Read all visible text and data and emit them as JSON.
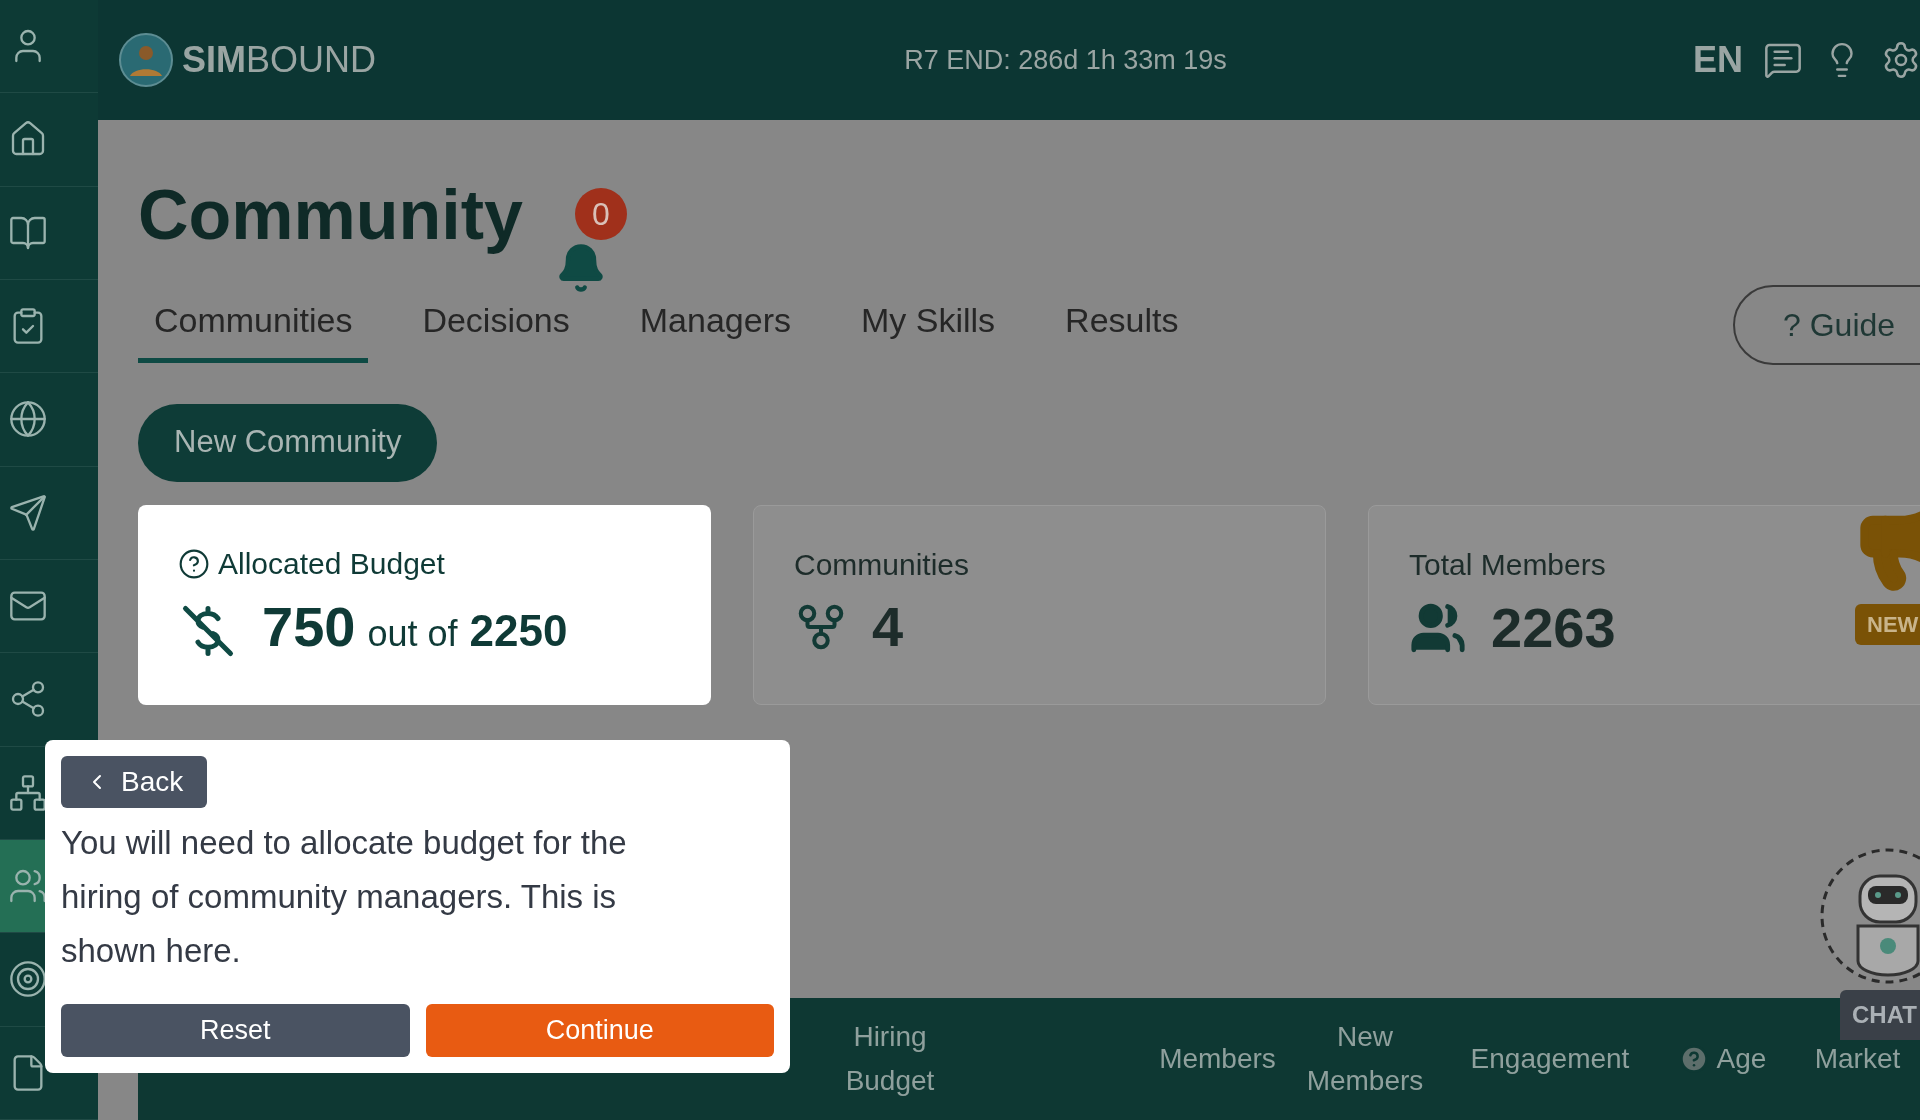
{
  "header": {
    "logo": "**SIM**BOUND",
    "timer": "R7 END: 286d 1h 33m 19s",
    "language": "EN"
  },
  "sidebar": {
    "items": [
      {
        "selected": false
      },
      {
        "selected": false
      },
      {
        "selected": false
      },
      {
        "selected": false
      },
      {
        "selected": false
      },
      {
        "selected": false
      },
      {
        "selected": false
      },
      {
        "selected": false
      },
      {
        "selected": false
      },
      {
        "selected": true
      },
      {
        "selected": false
      },
      {
        "selected": false
      }
    ]
  },
  "page": {
    "title": "Community",
    "notification_count": "0"
  },
  "tabs": [
    {
      "label": "Communities",
      "selected": true
    },
    {
      "label": "Decisions",
      "selected": false
    },
    {
      "label": "Managers",
      "selected": false
    },
    {
      "label": "My Skills",
      "selected": false
    },
    {
      "label": "Results",
      "selected": false
    }
  ],
  "guide_button": "? Guide",
  "new_community_button": "New Community",
  "stats": [
    {
      "kind": "budget",
      "label": "Allocated Budget",
      "value": "750",
      "connector": "out of",
      "total": "2250",
      "highlighted": true
    },
    {
      "kind": "communities",
      "label": "Communities",
      "value": "4",
      "highlighted": false
    },
    {
      "kind": "members",
      "label": "Total Members",
      "value": "2263",
      "highlighted": false
    }
  ],
  "news_badge": "NEW",
  "chat_label": "CHAT",
  "table": {
    "columns": [
      {
        "label": "Hiring Budget",
        "help": false
      },
      {
        "label": "Members",
        "help": false
      },
      {
        "label": "New Members",
        "help": false
      },
      {
        "label": "Engagement",
        "help": false
      },
      {
        "label": "Age",
        "help": true
      },
      {
        "label": "Market",
        "help": false
      }
    ]
  },
  "tour": {
    "back": "Back",
    "text": "You will need to allocate budget for the hiring of community managers. This is shown here.",
    "reset": "Reset",
    "continue": "Continue"
  }
}
